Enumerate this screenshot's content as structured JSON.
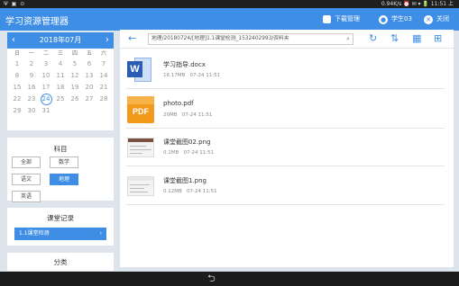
{
  "status": {
    "left_icons": "Ψ ▣ ⊙",
    "right": "0.94K/s ⏰ ✉ ▾ 🔋 11:51 上"
  },
  "app": {
    "title": "学习资源管理器",
    "download_label": "下载管理",
    "user_label": "学生03",
    "close_label": "关闭"
  },
  "calendar": {
    "month": "2018年07月",
    "weekdays": [
      "日",
      "一",
      "二",
      "三",
      "四",
      "五",
      "六"
    ],
    "days": [
      "1",
      "2",
      "3",
      "4",
      "5",
      "6",
      "7",
      "8",
      "9",
      "10",
      "11",
      "12",
      "13",
      "14",
      "15",
      "16",
      "17",
      "18",
      "19",
      "20",
      "21",
      "22",
      "23",
      "24",
      "25",
      "26",
      "27",
      "28",
      "29",
      "30",
      "31"
    ],
    "today": "24"
  },
  "subjects": {
    "title": "科目",
    "items": [
      "全部",
      "数学",
      "语文",
      "地理",
      "英语"
    ],
    "active": "地理"
  },
  "records": {
    "title": "课堂记录",
    "item": "1.1课堂检测"
  },
  "category": {
    "title": "分类"
  },
  "browser": {
    "path": "地理/20180724/[地理]1.1课堂检测_1532402993/资料夹",
    "files": [
      {
        "name": "学习指导.docx",
        "size": "16.17MB",
        "date": "07-24 11:51",
        "type": "word"
      },
      {
        "name": "photo.pdf",
        "size": "20MB",
        "date": "07-24 11:51",
        "type": "pdf"
      },
      {
        "name": "课堂截图02.png",
        "size": "0.1MB",
        "date": "07-24 11:51",
        "type": "image"
      },
      {
        "name": "课堂截图1.png",
        "size": "0.12MB",
        "date": "07-24 11:51",
        "type": "image"
      }
    ]
  },
  "icons": {
    "back": "←",
    "search": "⌕",
    "refresh": "↻",
    "sort": "⇅",
    "grid": "▦",
    "add_folder": "⊞",
    "home": "⮌"
  },
  "colors": {
    "accent": "#3f8ee6",
    "background": "#dde4ec",
    "word": "#2b5cb3",
    "pdf": "#f39a1c"
  }
}
